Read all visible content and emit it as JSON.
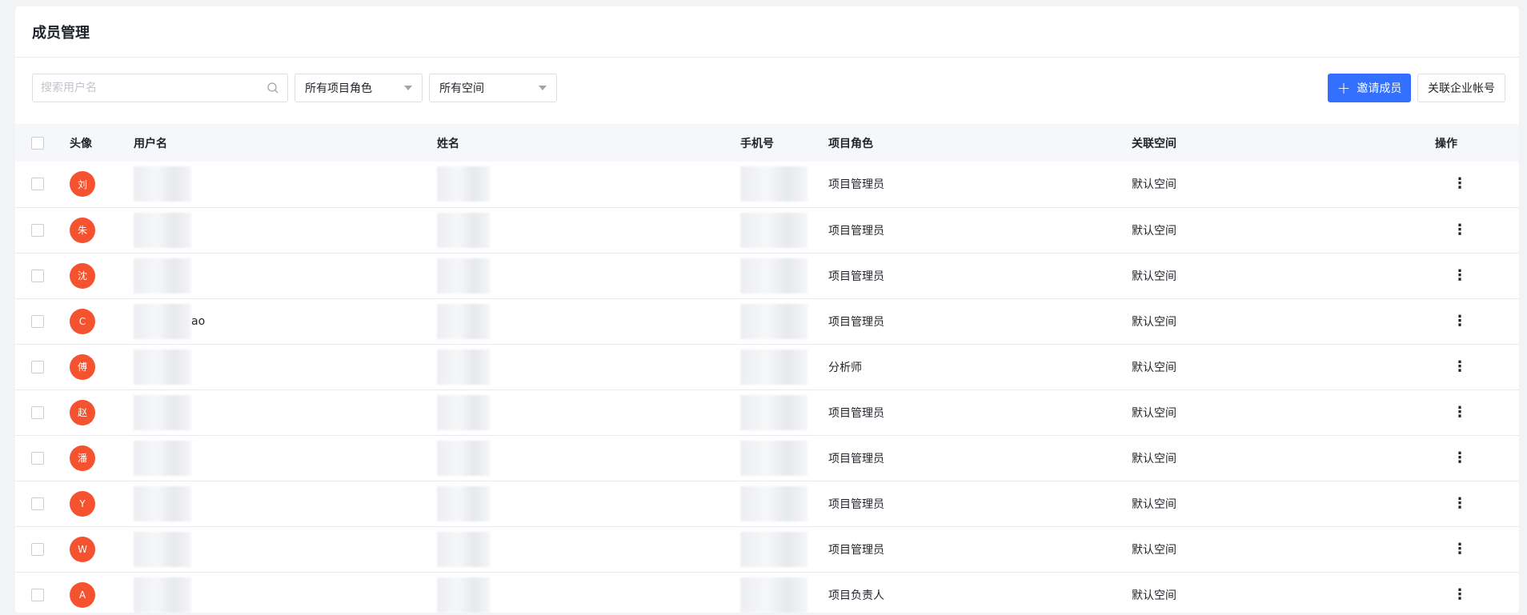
{
  "page": {
    "title": "成员管理"
  },
  "toolbar": {
    "search_placeholder": "搜索用户名",
    "role_filter": "所有项目角色",
    "space_filter": "所有空间",
    "invite_label": "邀请成员",
    "link_label": "关联企业帐号"
  },
  "table": {
    "headers": {
      "avatar": "头像",
      "username": "用户名",
      "name": "姓名",
      "phone": "手机号",
      "role": "项目角色",
      "space": "关联空间",
      "op": "操作"
    },
    "rows": [
      {
        "avatar": "刘",
        "username_suffix": "",
        "role": "项目管理员",
        "space": "默认空间"
      },
      {
        "avatar": "朱",
        "username_suffix": "",
        "role": "项目管理员",
        "space": "默认空间"
      },
      {
        "avatar": "沈",
        "username_suffix": "",
        "role": "项目管理员",
        "space": "默认空间"
      },
      {
        "avatar": "C",
        "username_suffix": "ao",
        "role": "项目管理员",
        "space": "默认空间"
      },
      {
        "avatar": "傅",
        "username_suffix": "",
        "role": "分析师",
        "space": "默认空间"
      },
      {
        "avatar": "赵",
        "username_suffix": "",
        "role": "项目管理员",
        "space": "默认空间"
      },
      {
        "avatar": "潘",
        "username_suffix": "",
        "role": "项目管理员",
        "space": "默认空间"
      },
      {
        "avatar": "Y",
        "username_suffix": "",
        "role": "项目管理员",
        "space": "默认空间"
      },
      {
        "avatar": "W",
        "username_suffix": "",
        "role": "项目管理员",
        "space": "默认空间"
      },
      {
        "avatar": "A",
        "username_suffix": "",
        "role": "项目负责人",
        "space": "默认空间"
      }
    ]
  },
  "colors": {
    "primary": "#3370ff",
    "avatar_bg": "#f5532f"
  },
  "icons": {
    "search": "search-icon",
    "more": "more-vertical-icon",
    "plus": "plus-icon",
    "caret": "caret-down-icon"
  }
}
